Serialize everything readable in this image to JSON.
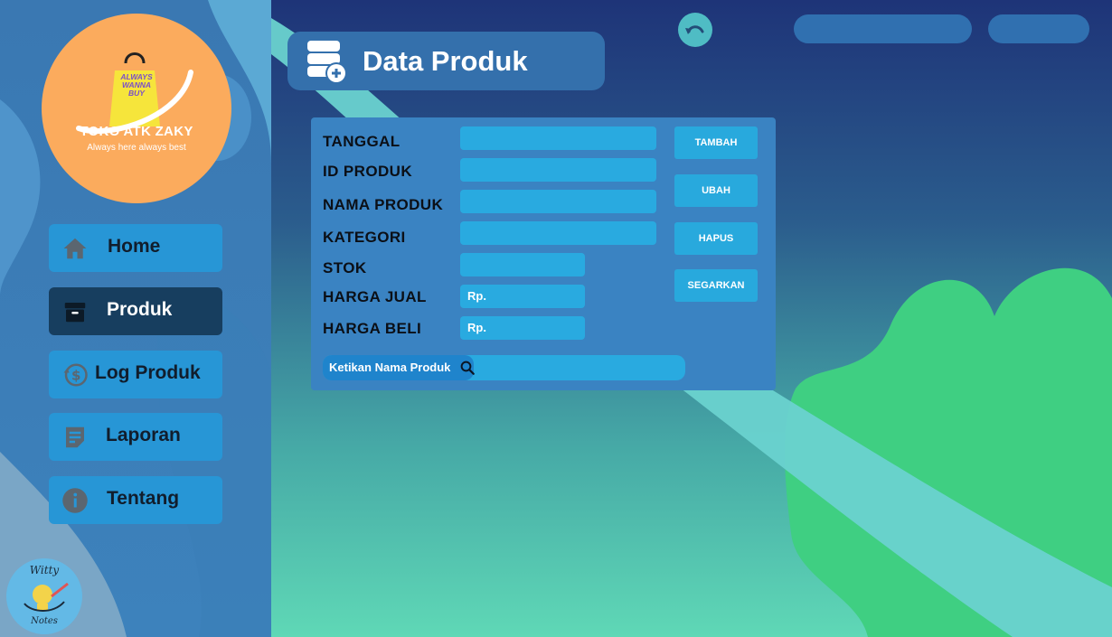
{
  "app": {
    "logo_title": "TOKO ATK ZAKY",
    "logo_subtitle": "Always here always best",
    "logo_bag_lines": [
      "ALWAYS",
      "WANNA",
      "BUY"
    ],
    "corner_logo_title": "Witty",
    "corner_logo_sub": "Notes"
  },
  "sidebar": {
    "items": [
      {
        "label": "Home",
        "icon": "home-icon",
        "active": false
      },
      {
        "label": "Produk",
        "icon": "archive-box-icon",
        "active": true
      },
      {
        "label": "Log Produk",
        "icon": "money-history-icon",
        "active": false
      },
      {
        "label": "Laporan",
        "icon": "report-note-icon",
        "active": false
      },
      {
        "label": "Tentang",
        "icon": "info-icon",
        "active": false
      }
    ]
  },
  "header": {
    "title": "Data Produk",
    "icon": "database-add-icon"
  },
  "toolbar": {
    "undo_icon": "undo-icon"
  },
  "form": {
    "fields": [
      {
        "label": "TANGGAL",
        "value": ""
      },
      {
        "label": "ID PRODUK",
        "value": ""
      },
      {
        "label": "NAMA PRODUK",
        "value": ""
      },
      {
        "label": "KATEGORI",
        "value": ""
      },
      {
        "label": "STOK",
        "value": ""
      },
      {
        "label": "HARGA JUAL",
        "value": "Rp."
      },
      {
        "label": "HARGA BELI",
        "value": "Rp."
      }
    ],
    "buttons": {
      "add": "TAMBAH",
      "edit": "UBAH",
      "delete": "HAPUS",
      "refresh": "SEGARKAN"
    },
    "search": {
      "label": "Ketikan Nama Produk",
      "value": ""
    }
  },
  "colors": {
    "sidebar_button": "#2796d6",
    "sidebar_active": "#173e5f",
    "logo_circle": "#fbab5d",
    "panel": "#3a83c2",
    "input": "#29aae0"
  }
}
